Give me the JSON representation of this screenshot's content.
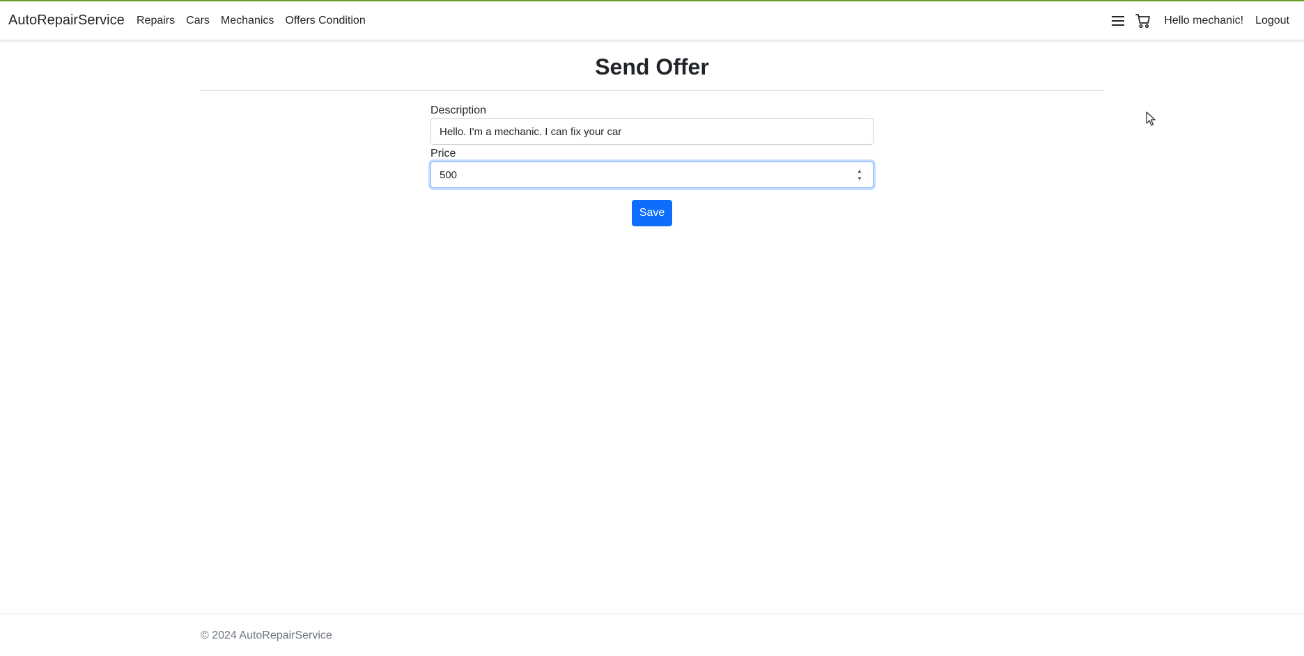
{
  "app": {
    "brand": "AutoRepairService",
    "accent_color": "#6aa121"
  },
  "nav": {
    "links": [
      {
        "label": "Repairs"
      },
      {
        "label": "Cars"
      },
      {
        "label": "Mechanics"
      },
      {
        "label": "Offers Condition"
      }
    ],
    "menu_icon": "hamburger-icon",
    "cart_icon": "cart-icon",
    "greeting": "Hello mechanic!",
    "logout": "Logout"
  },
  "page": {
    "title": "Send Offer"
  },
  "form": {
    "description_label": "Description",
    "description_value": "Hello. I'm a mechanic. I can fix your car",
    "price_label": "Price",
    "price_value": "500",
    "save_label": "Save",
    "save_color": "#0d6efd"
  },
  "footer": {
    "text": "© 2024 AutoRepairService"
  }
}
